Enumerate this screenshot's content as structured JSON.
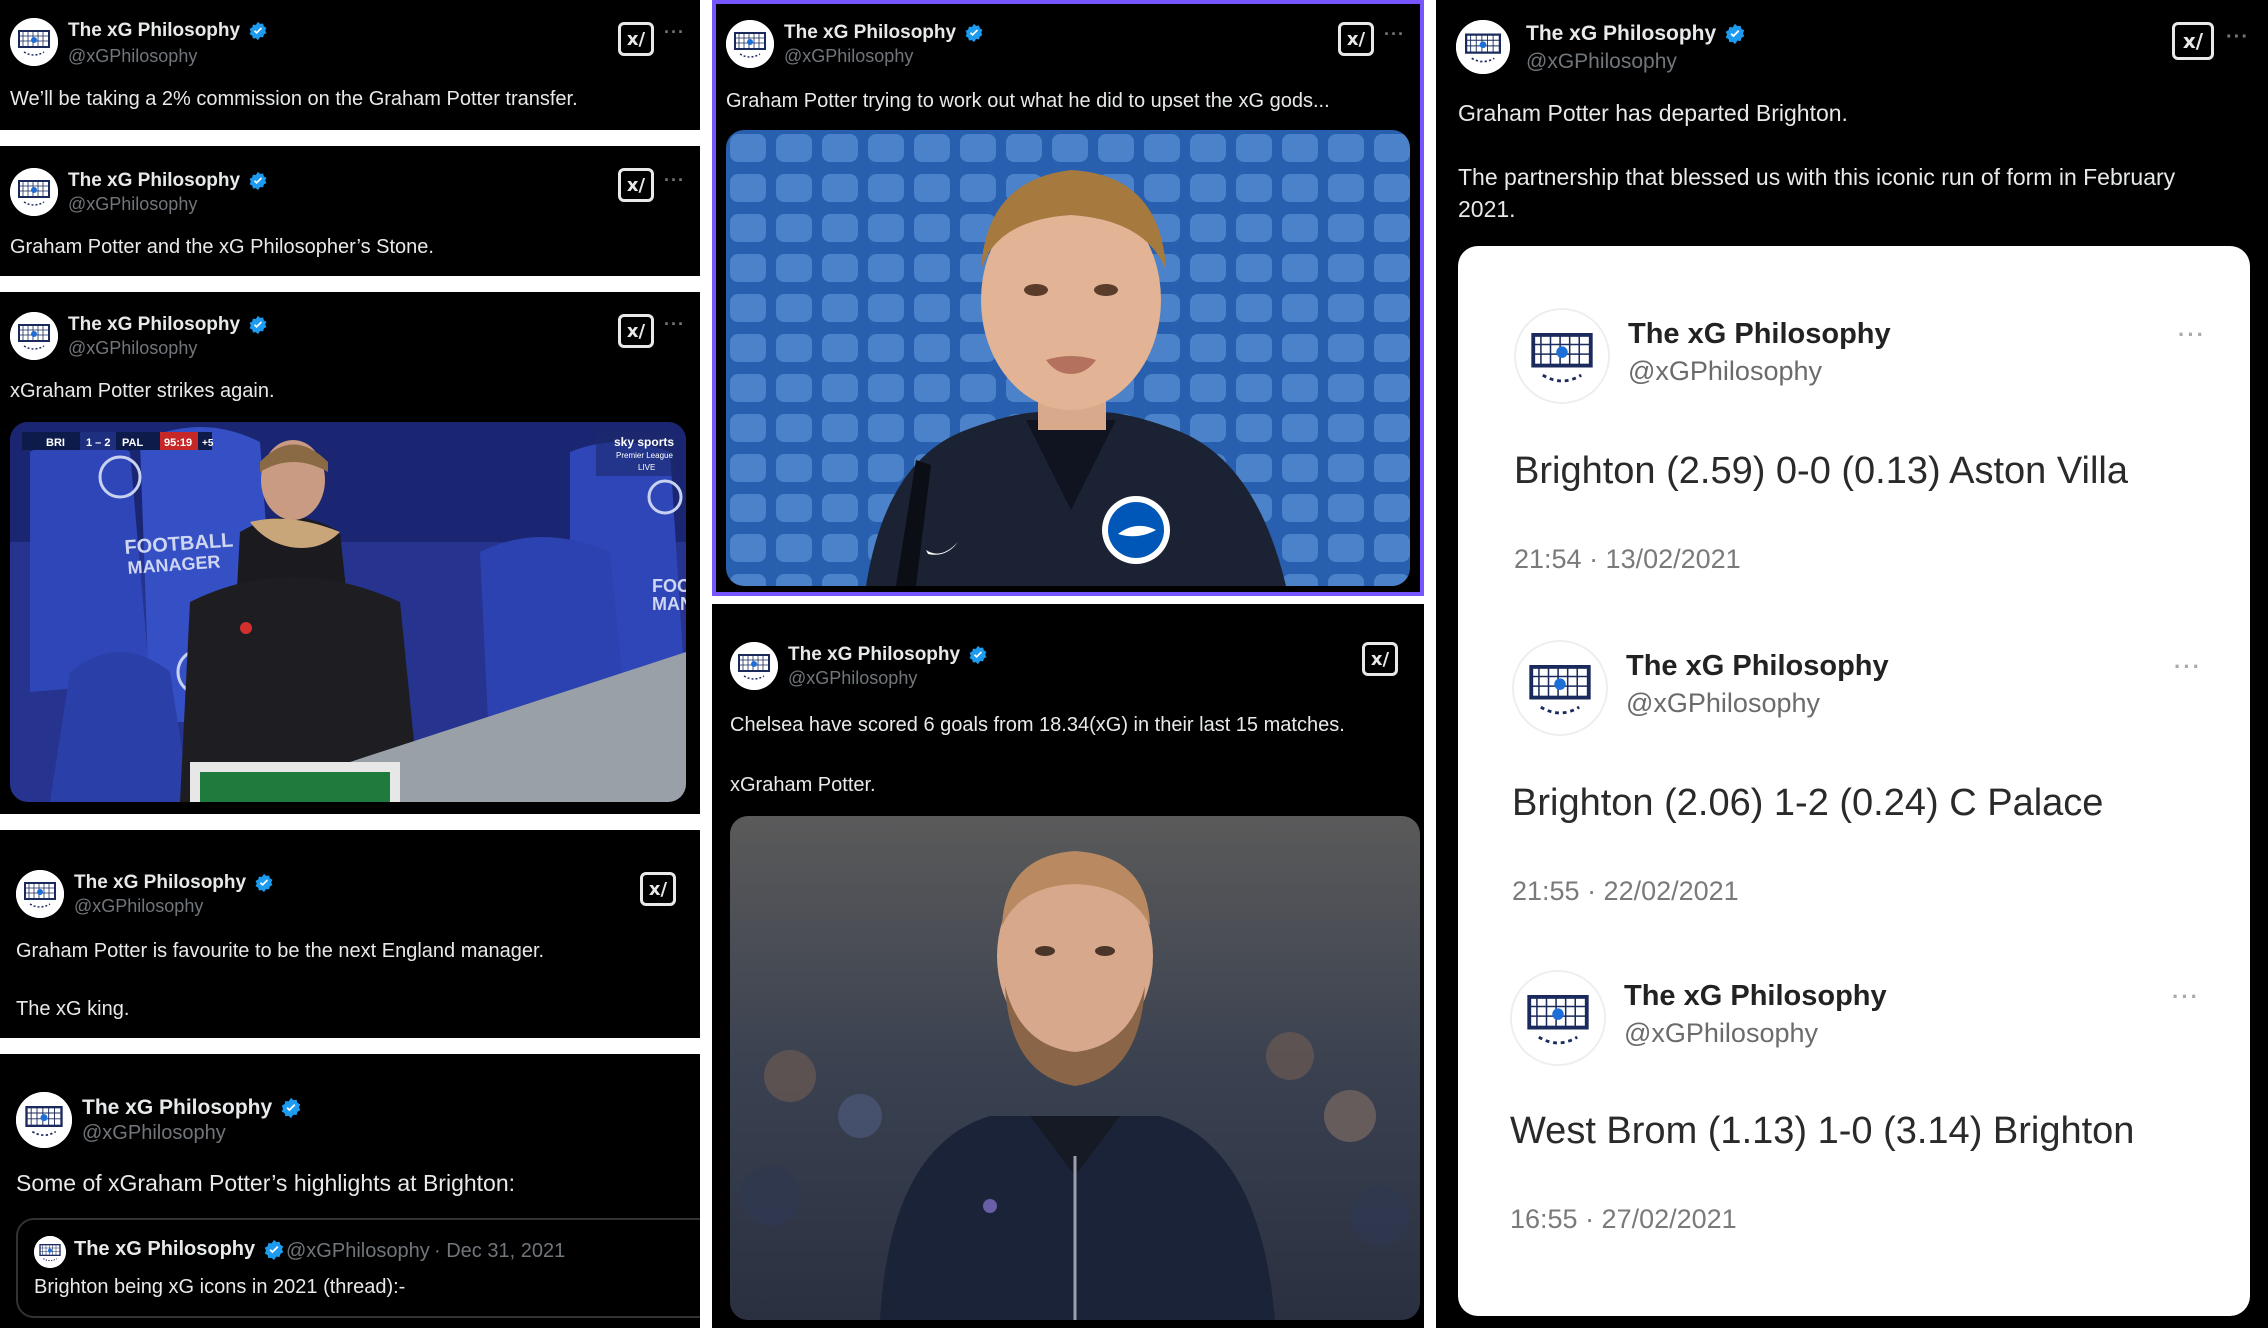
{
  "account": {
    "name": "The xG Philosophy",
    "handle": "@xGPhilosophy"
  },
  "icons": {
    "avatar": "goal-net-logo",
    "verified": "verified-badge-icon",
    "grok": "grok-icon",
    "more": "more-dots-icon"
  },
  "colors": {
    "verified": "#1d9bf0",
    "highlight_border": "#7856ff",
    "brighton_blue": "#0057b8"
  },
  "more_label": "···",
  "grok_label": "x/",
  "tweets": [
    {
      "text": "We’ll be taking a 2% commission on the Graham Potter transfer."
    },
    {
      "text": "Graham Potter and the xG Philosopher’s Stone."
    },
    {
      "text": "xGraham Potter strikes again.",
      "media": {
        "scorebug": {
          "home": "BRI",
          "score": "1 – 2",
          "away": "PAL",
          "clock": "95:19",
          "added": "+5"
        },
        "broadcaster": "sky sports",
        "league": "Premier League",
        "live": "LIVE",
        "seat_text": "FOOTBALL MANAGER",
        "seat_text_right": "FOOT MAN"
      }
    },
    {
      "text_lines": [
        "Graham Potter is favourite to be the next England manager.",
        "The xG king."
      ]
    },
    {
      "text": "Some of xGraham Potter’s highlights at Brighton:",
      "quote": {
        "name": "The xG Philosophy",
        "handle": "@xGPhilosophy",
        "date": "· Dec 31, 2021",
        "text": "Brighton being xG icons in 2021 (thread):-"
      }
    },
    {
      "text": "Graham Potter trying to work out what he did to upset the xG gods..."
    },
    {
      "text_lines": [
        "Chelsea have scored 6 goals from 18.34(xG) in their last 15 matches.",
        "xGraham Potter."
      ]
    },
    {
      "text_lines": [
        "Graham Potter has departed Brighton.",
        "The partnership that blessed us with this iconic run of form in February",
        "2021."
      ],
      "embedded": [
        {
          "name": "The xG Philosophy",
          "handle": "@xGPhilosophy",
          "score": "Brighton (2.59) 0-0 (0.13) Aston Villa",
          "time": "21:54 · 13/02/2021"
        },
        {
          "name": "The xG Philosophy",
          "handle": "@xGPhilosophy",
          "score": "Brighton (2.06) 1-2 (0.24) C Palace",
          "time": "21:55 · 22/02/2021"
        },
        {
          "name": "The xG Philosophy",
          "handle": "@xGPhilosophy",
          "score": "West Brom (1.13) 1-0 (3.14) Brighton",
          "time": "16:55 · 27/02/2021"
        }
      ]
    }
  ]
}
